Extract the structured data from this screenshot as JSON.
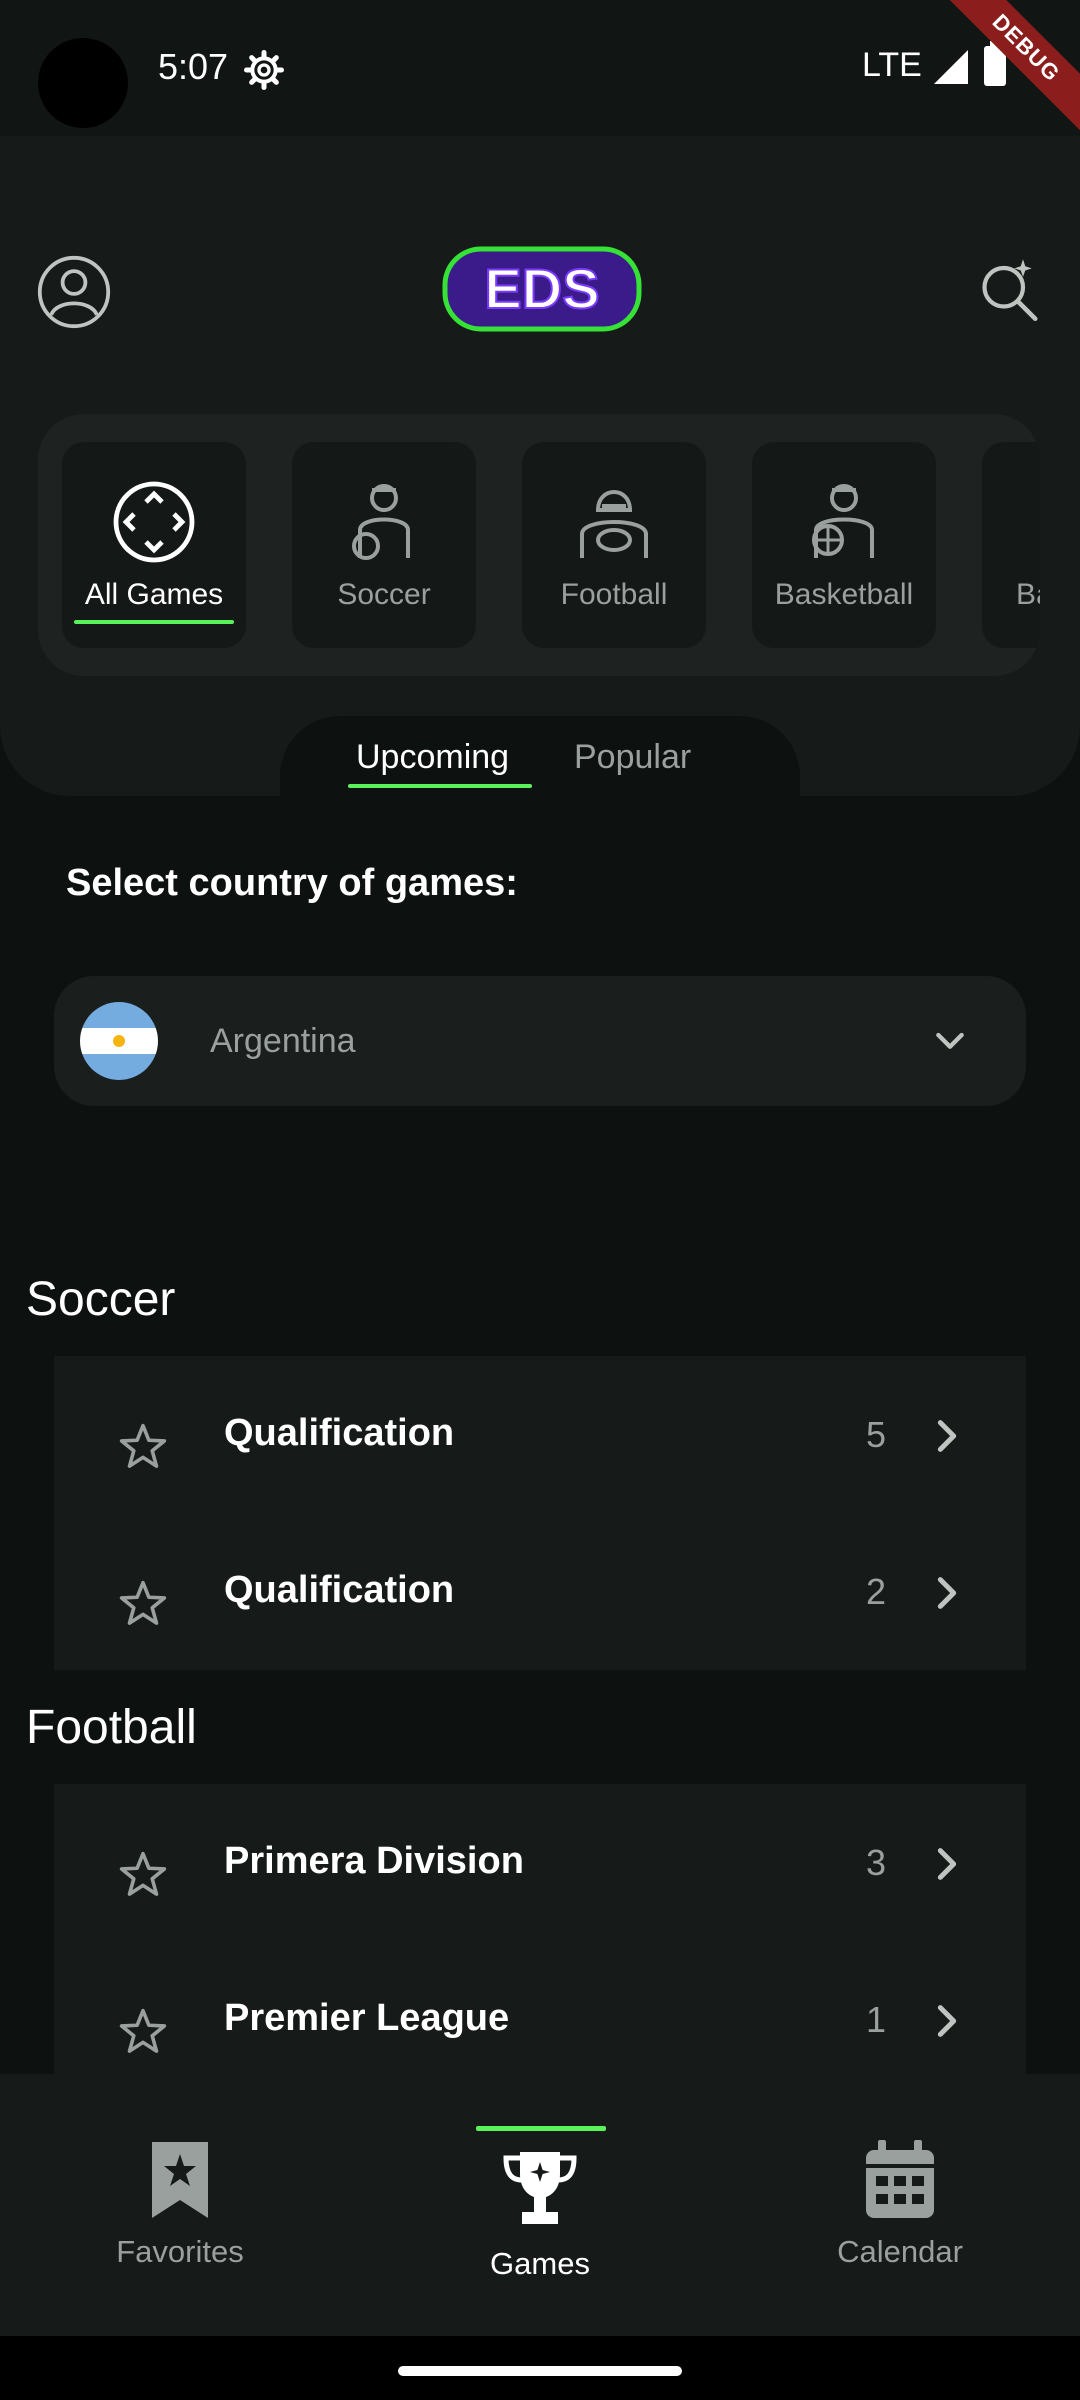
{
  "status": {
    "time": "5:07",
    "network": "LTE",
    "debug": "DEBUG"
  },
  "header": {
    "logo_text": "EDS"
  },
  "sports": [
    {
      "label": "All Games",
      "icon": "all-games-icon"
    },
    {
      "label": "Soccer",
      "icon": "soccer-player-icon"
    },
    {
      "label": "Football",
      "icon": "football-player-icon"
    },
    {
      "label": "Basketball",
      "icon": "basketball-player-icon"
    },
    {
      "label": "Ba",
      "icon": "partial-sport-icon"
    }
  ],
  "tabs": {
    "upcoming": "Upcoming",
    "popular": "Popular"
  },
  "country": {
    "title": "Select country of games:",
    "selected": "Argentina"
  },
  "sections": [
    {
      "title": "Soccer",
      "leagues": [
        {
          "name": "Qualification",
          "count": "5"
        },
        {
          "name": "Qualification",
          "count": "2"
        }
      ]
    },
    {
      "title": "Football",
      "leagues": [
        {
          "name": "Primera Division",
          "count": "3"
        },
        {
          "name": "Premier League",
          "count": "1"
        }
      ]
    }
  ],
  "nav": {
    "favorites": "Favorites",
    "games": "Games",
    "calendar": "Calendar"
  },
  "colors": {
    "accent": "#5af25a",
    "background": "#0d1110",
    "card": "#161a19",
    "muted": "#9aa09d"
  }
}
